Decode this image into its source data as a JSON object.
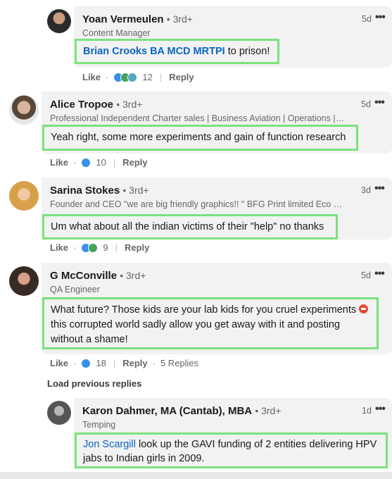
{
  "comments": [
    {
      "name": "Yoan Vermeulen",
      "degree": "• 3rd+",
      "headline": "Content Manager",
      "time": "5d",
      "more": "•••",
      "mention": "Brian Crooks BA MCD MRTPI",
      "text": " to prison!",
      "like": "Like",
      "reaction_count": "12",
      "reply": "Reply"
    },
    {
      "name": "Alice Tropoe",
      "degree": "• 3rd+",
      "headline": "Professional Independent Charter sales | Business Aviation | Operations | C...",
      "time": "5d",
      "more": "•••",
      "text": "Yeah right, some more experiments and gain of function research",
      "like": "Like",
      "reaction_count": "10",
      "reply": "Reply"
    },
    {
      "name": "Sarina Stokes",
      "degree": "• 3rd+",
      "headline": "Founder and CEO \"we are big friendly graphics!! \" BFG Print limited Eco an...",
      "time": "3d",
      "more": "•••",
      "text": "Um what about all the indian victims of their \"help\" no thanks",
      "like": "Like",
      "reaction_count": "9",
      "reply": "Reply"
    },
    {
      "name": "G McConville",
      "degree": "• 3rd+",
      "headline": "QA Engineer",
      "time": "5d",
      "more": "•••",
      "text_line1": "What future? Those kids are your lab kids for you cruel experiments",
      "text_line2": "this corrupted world sadly allow you get away with it and posting",
      "text_line3": "without a shame!",
      "like": "Like",
      "reaction_count": "18",
      "reply": "Reply",
      "replies": "5 Replies"
    },
    {
      "name": "Karon Dahmer, MA (Cantab), MBA",
      "degree": "• 3rd+",
      "headline": "Temping",
      "time": "1d",
      "more": "•••",
      "mention": "Jon Scargill",
      "text_line1": " look up the GAVI funding of 2 entities delivering HPV",
      "text_line2": "jabs to Indian girls in 2009."
    }
  ],
  "load_previous": "Load previous replies",
  "colors": {
    "highlight": "#7be27d",
    "link": "#0a66c2",
    "bubble": "#f2f2f2",
    "like_blue": "#378fe9",
    "celebrate_green": "#44a25c",
    "support_teal": "#59a7bf"
  },
  "icons": [
    "like-reaction-icon",
    "celebrate-reaction-icon",
    "insightful-reaction-icon",
    "angry-emoji-icon",
    "more-options-icon"
  ]
}
